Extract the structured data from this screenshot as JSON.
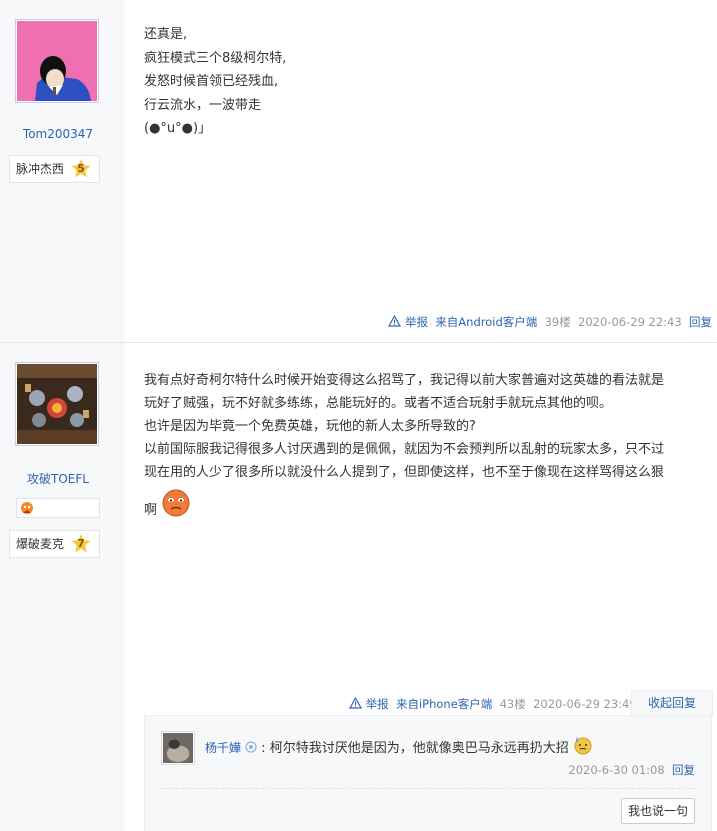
{
  "post1": {
    "username": "Tom200347",
    "badge_label": "脉冲杰西",
    "badge_level": "5",
    "lines": [
      "还真是,",
      "疯狂模式三个8级柯尔特,",
      "发怒时候首领已经残血,",
      "行云流水，一波带走",
      "(●°u°●)」"
    ],
    "report": "举报",
    "client": "来自Android客户端",
    "floor": "39楼",
    "time": "2020-06-29 22:43",
    "reply": "回复"
  },
  "post2": {
    "username": "攻破TOEFL",
    "badge_label": "爆破麦克",
    "badge_level": "7",
    "lines": [
      "我有点好奇柯尔特什么时候开始变得这么招骂了，我记得以前大家普遍对这英雄的看法就是",
      "玩好了贼强，玩不好就多练练，总能玩好的。或者不适合玩射手就玩点其他的呗。",
      "也许是因为毕竟一个免费英雄，玩他的新人太多所导致的?",
      "以前国际服我记得很多人讨厌遇到的是佩佩，就因为不会预判所以乱射的玩家太多，只不过",
      "现在用的人少了很多所以就没什么人提到了，但即使这样，也不至于像现在这样骂得这么狠",
      "啊"
    ],
    "report": "举报",
    "client": "来自iPhone客户端",
    "floor": "43楼",
    "time": "2020-06-29 23:49",
    "collapse": "收起回复"
  },
  "comment": {
    "username": "杨千嬅",
    "text": ": 柯尔特我讨厌他是因为，他就像奥巴马永远再扔大招",
    "time": "2020-6-30 01:08",
    "reply": "回复",
    "say_button": "我也说一句"
  },
  "colors": {
    "link": "#2d64b3",
    "meta": "#999999",
    "sidebar": "#f7f8fa"
  }
}
